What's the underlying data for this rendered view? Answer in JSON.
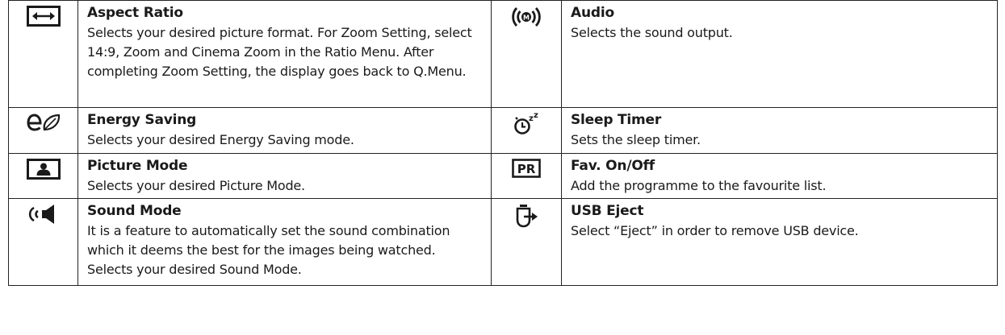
{
  "rows": [
    {
      "left": {
        "icon": "aspect-ratio-icon",
        "title": "Aspect Ratio",
        "description": "Selects your desired picture format. For Zoom Setting, select 14:9, Zoom and Cinema Zoom in the Ratio Menu. After completing Zoom Setting, the display goes back to Q.Menu."
      },
      "right": {
        "icon": "audio-icon",
        "title": "Audio",
        "description": "Selects the sound output."
      }
    },
    {
      "left": {
        "icon": "energy-saving-icon",
        "title": "Energy Saving",
        "description": "Selects your desired Energy Saving mode."
      },
      "right": {
        "icon": "sleep-timer-icon",
        "title": "Sleep Timer",
        "description": "Sets the sleep timer."
      }
    },
    {
      "left": {
        "icon": "picture-mode-icon",
        "title": "Picture Mode",
        "description": "Selects your desired Picture Mode."
      },
      "right": {
        "icon": "pr-fav-icon",
        "icon_text": "PR",
        "title": "Fav. On/Off",
        "description": "Add the programme to the favourite list."
      }
    },
    {
      "left": {
        "icon": "sound-mode-icon",
        "title": "Sound Mode",
        "description": "It is a feature to automatically set the sound combination which it deems the best for the images being watched. Selects your desired Sound Mode."
      },
      "right": {
        "icon": "usb-eject-icon",
        "title": "USB Eject",
        "description": "Select “Eject” in order to remove USB device."
      }
    }
  ]
}
